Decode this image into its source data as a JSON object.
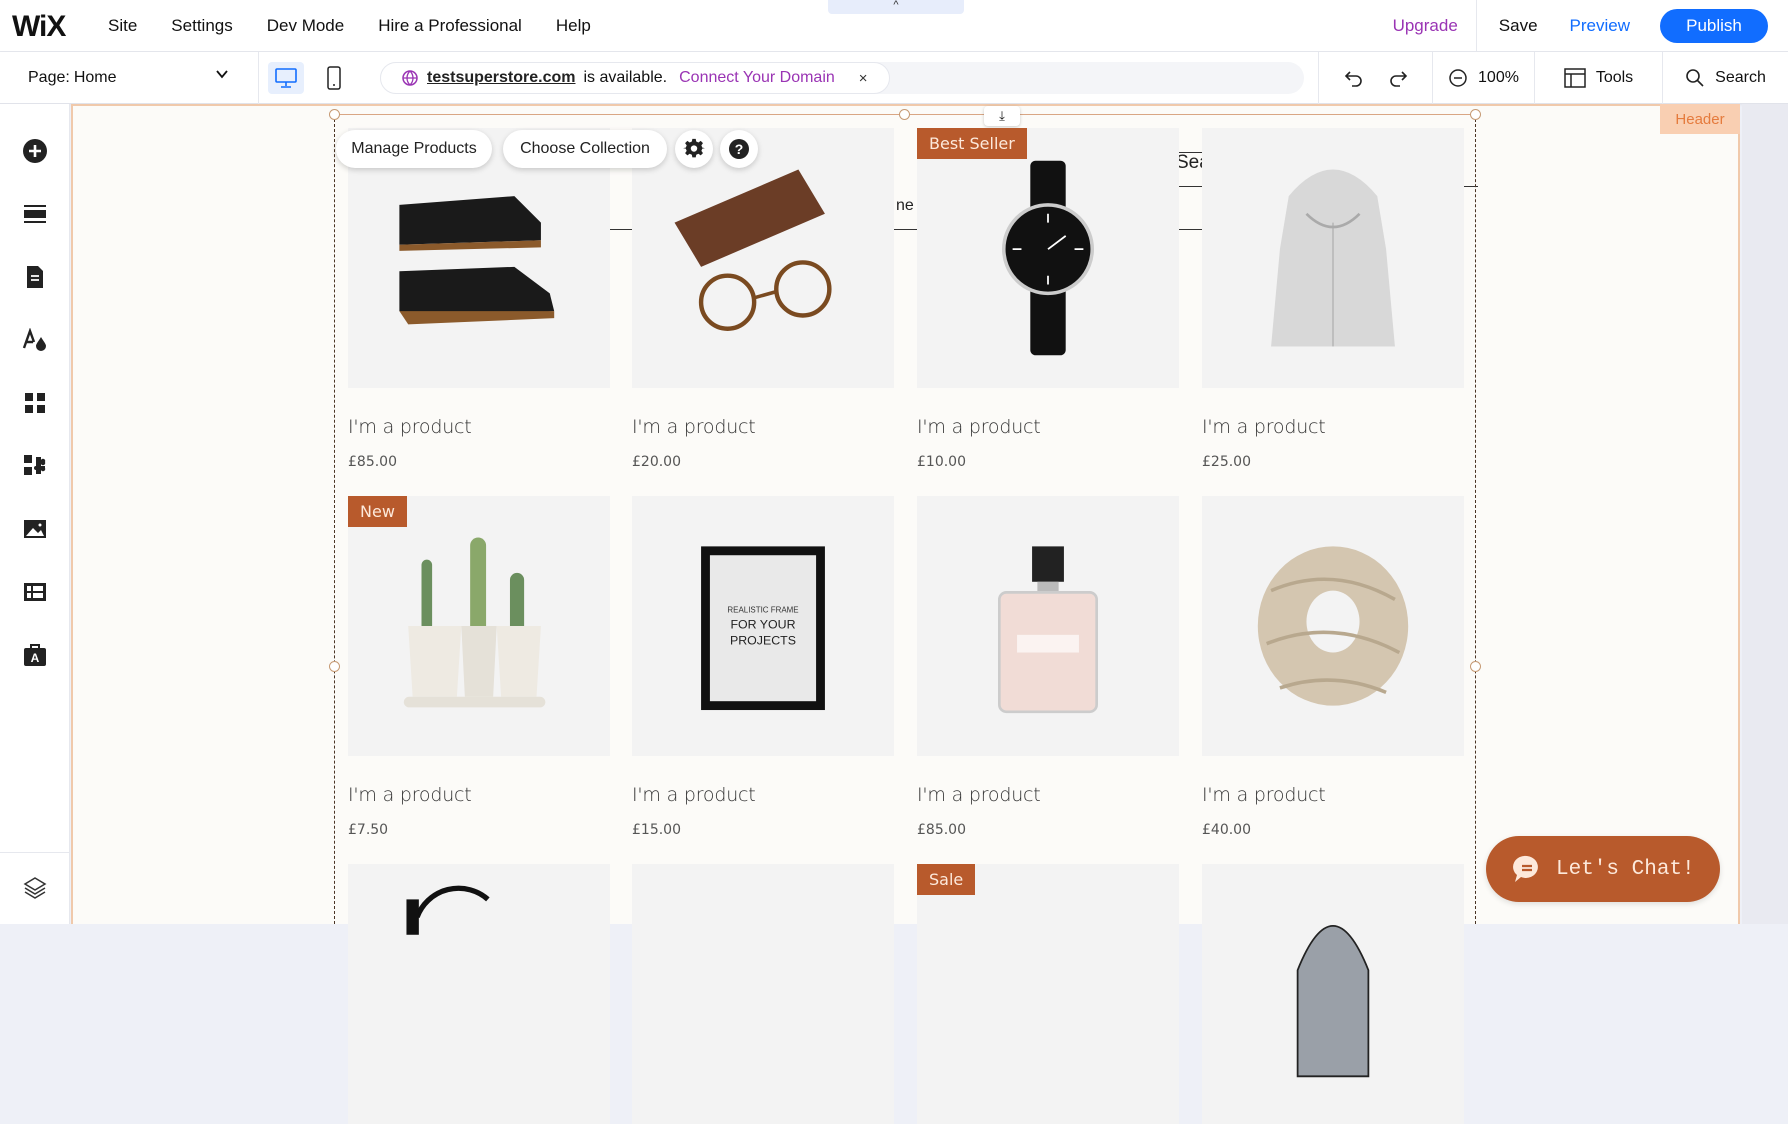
{
  "topbar": {
    "logo": "WiX",
    "menu": [
      "Site",
      "Settings",
      "Dev Mode",
      "Hire a Professional",
      "Help"
    ],
    "collapse_icon": "^",
    "upgrade": "Upgrade",
    "save": "Save",
    "preview": "Preview",
    "publish": "Publish"
  },
  "secondbar": {
    "page_label": "Page:",
    "page_value": "Home",
    "domain": "testsuperstore.com",
    "domain_status": "is available.",
    "connect": "Connect Your Domain",
    "close": "×",
    "zoom": "100%",
    "tools": "Tools",
    "search": "Search"
  },
  "sidebar": {
    "items": [
      "add-elements",
      "sections",
      "pages",
      "theme",
      "apps",
      "wix-app-market",
      "media",
      "cms",
      "business"
    ],
    "bottom": "layers"
  },
  "canvas": {
    "header_tag": "Header",
    "bg_text_1": "ne",
    "bg_text_2": "Sea",
    "overlay": {
      "manage_products": "Manage Products",
      "choose_collection": "Choose Collection"
    }
  },
  "products": [
    {
      "name": "I'm a product",
      "price": "£85.00",
      "ribbon": "",
      "image": "boots"
    },
    {
      "name": "I'm a product",
      "price": "£20.00",
      "ribbon": "",
      "image": "glasses"
    },
    {
      "name": "I'm a product",
      "price": "£10.00",
      "ribbon": "Best Seller",
      "image": "watch"
    },
    {
      "name": "I'm a product",
      "price": "£25.00",
      "ribbon": "",
      "image": "hoodie"
    },
    {
      "name": "I'm a product",
      "price": "£7.50",
      "ribbon": "New",
      "image": "cactus"
    },
    {
      "name": "I'm a product",
      "price": "£15.00",
      "ribbon": "",
      "image": "frame"
    },
    {
      "name": "I'm a product",
      "price": "£85.00",
      "ribbon": "",
      "image": "perfume"
    },
    {
      "name": "I'm a product",
      "price": "£40.00",
      "ribbon": "",
      "image": "scarf"
    },
    {
      "name": "",
      "price": "",
      "ribbon": "",
      "image": "headphones"
    },
    {
      "name": "",
      "price": "",
      "ribbon": "",
      "image": "blank"
    },
    {
      "name": "",
      "price": "",
      "ribbon": "Sale",
      "image": "blank"
    },
    {
      "name": "",
      "price": "",
      "ribbon": "",
      "image": "backpack"
    }
  ],
  "frame_text": [
    "REALISTIC FRAME",
    "FOR YOUR",
    "PROJECTS"
  ],
  "chat": {
    "label": "Let's Chat!"
  },
  "colors": {
    "accent": "#116dff",
    "upgrade": "#9a34b4",
    "ribbon": "#b85a2c",
    "header_tag": "#f9cfb2"
  }
}
